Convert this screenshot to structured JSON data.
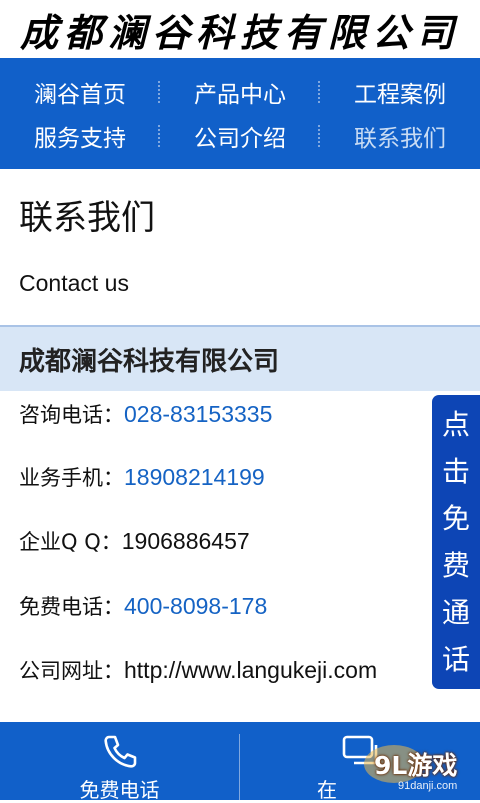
{
  "header": {
    "logo_text": "成都澜谷科技有限公司"
  },
  "nav": {
    "items": [
      {
        "label": "澜谷首页"
      },
      {
        "label": "产品中心"
      },
      {
        "label": "工程案例"
      },
      {
        "label": "服务支持"
      },
      {
        "label": "公司介绍"
      },
      {
        "label": "联系我们",
        "active": true
      }
    ]
  },
  "main": {
    "title": "联系我们",
    "subtitle": "Contact us",
    "company_name": "成都澜谷科技有限公司",
    "contacts": [
      {
        "label": "咨询电话：",
        "value": "028-83153335",
        "link": true
      },
      {
        "label": "业务手机：",
        "value": "18908214199",
        "link": true
      },
      {
        "label": "企业Q Q：",
        "value": "1906886457",
        "link": false
      },
      {
        "label": "免费电话：",
        "value": "400-8098-178",
        "link": true
      },
      {
        "label": "公司网址：",
        "value": "http://www.langukeji.com",
        "link": false
      }
    ]
  },
  "floating_button": {
    "label": "点击免费通话"
  },
  "bottom_bar": {
    "left_label": "免费电话",
    "left_icon": "phone-icon",
    "right_label": "在",
    "right_icon": "message-icon"
  },
  "watermark": {
    "brand": "9L游戏",
    "url": "91danji.com"
  },
  "colors": {
    "primary": "#1160c9",
    "float_button": "#0d45b5",
    "link": "#1563c4",
    "company_bar": "#d8e6f6"
  }
}
